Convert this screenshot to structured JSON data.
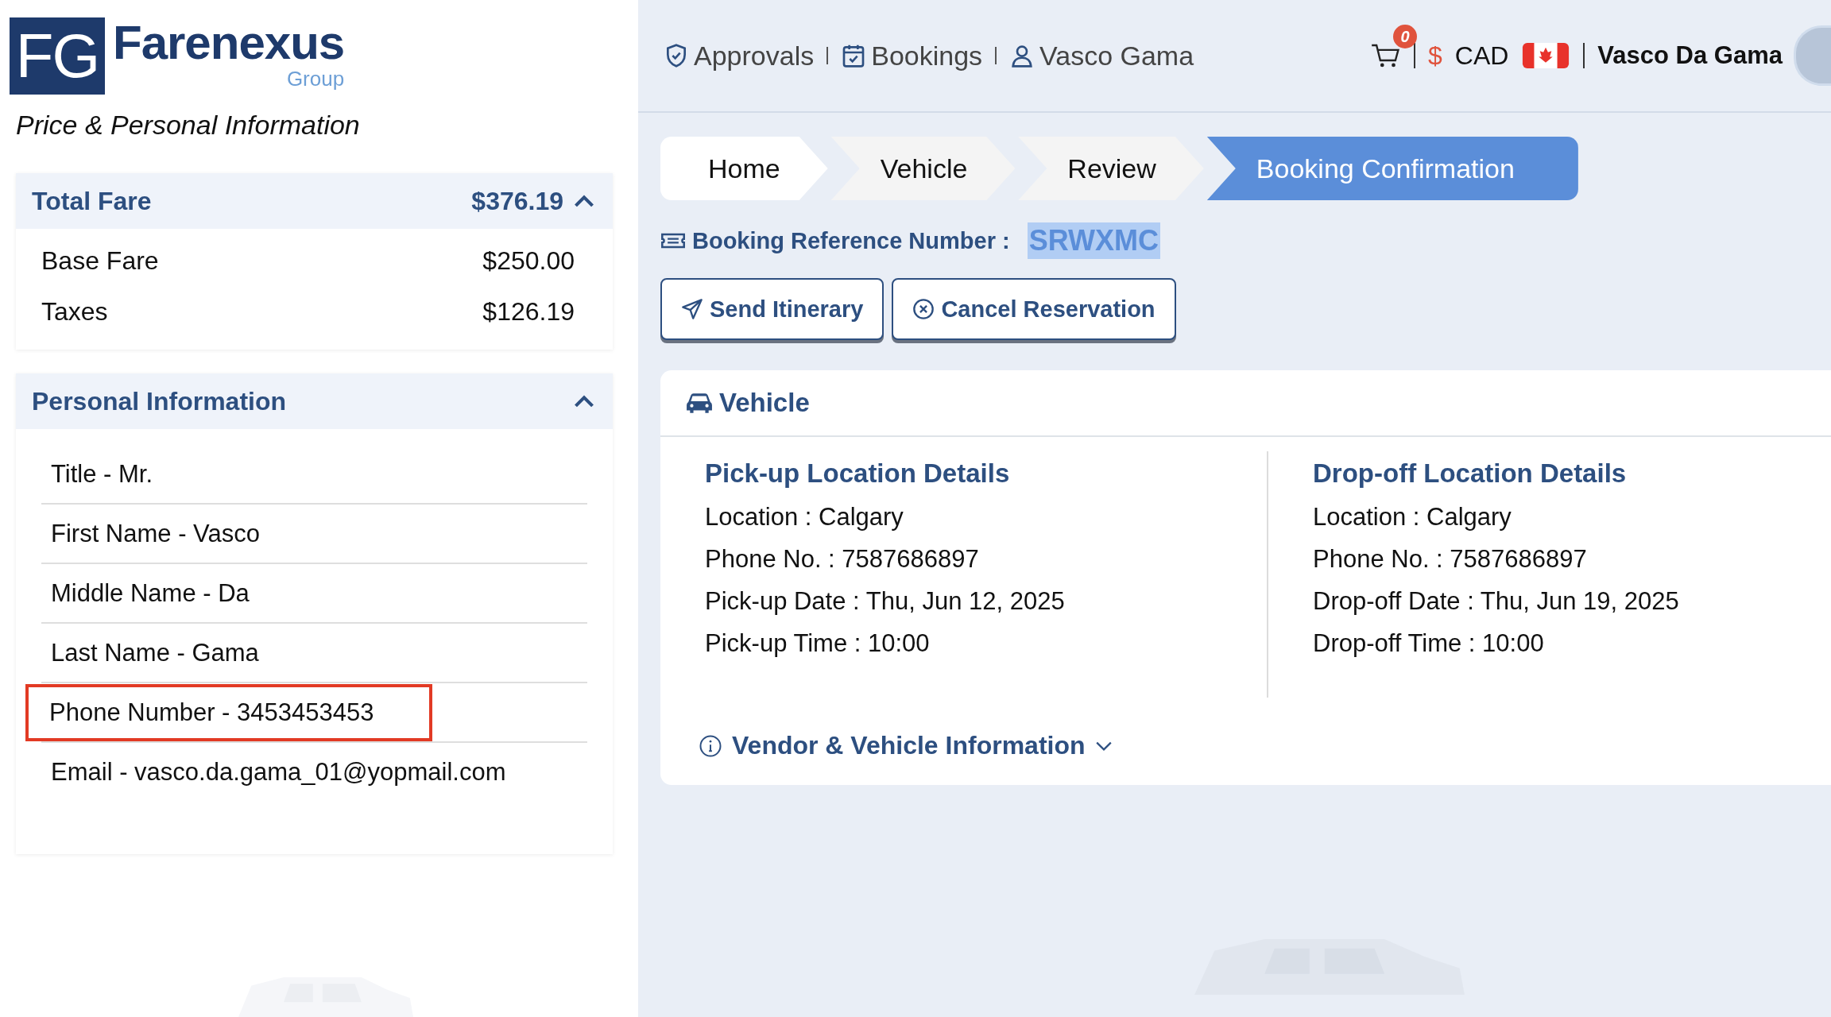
{
  "logo": {
    "mark": "FG",
    "name": "Farenexus",
    "sub": "Group"
  },
  "sidebar": {
    "title": "Price & Personal Information",
    "fare": {
      "title": "Total Fare",
      "total": "$376.19",
      "expanded": true,
      "rows": [
        {
          "label": "Base Fare",
          "value": "$250.00"
        },
        {
          "label": "Taxes",
          "value": "$126.19"
        }
      ]
    },
    "personal": {
      "title": "Personal Information",
      "expanded": true,
      "rows": [
        {
          "text": "Title - Mr.",
          "highlighted": false
        },
        {
          "text": "First Name - Vasco",
          "highlighted": false
        },
        {
          "text": "Middle Name - Da",
          "highlighted": false
        },
        {
          "text": "Last Name - Gama",
          "highlighted": false
        },
        {
          "text": "Phone Number - 3453453453",
          "highlighted": true
        },
        {
          "text": "Email - vasco.da.gama_01@yopmail.com",
          "highlighted": false
        }
      ]
    }
  },
  "nav": {
    "links": [
      {
        "kind": "shield",
        "label": "Approvals"
      },
      {
        "kind": "calendar",
        "label": "Bookings"
      },
      {
        "kind": "user",
        "label": "Vasco Gama"
      }
    ],
    "cart_count": "0",
    "currency_symbol": "$",
    "currency": "CAD",
    "user": "Vasco Da Gama"
  },
  "breadcrumb": [
    {
      "label": "Home",
      "selected": false
    },
    {
      "label": "Vehicle",
      "selected": false
    },
    {
      "label": "Review",
      "selected": false
    },
    {
      "label": "Booking Confirmation",
      "selected": true
    }
  ],
  "reference": {
    "label": "Booking Reference Number :",
    "value": "SRWXMC"
  },
  "buttons": [
    {
      "kind": "send",
      "label": "Send Itinerary"
    },
    {
      "kind": "cancel",
      "label": "Cancel Reservation"
    }
  ],
  "vehicle": {
    "title": "Vehicle",
    "columns": [
      {
        "title": "Pick-up Location Details",
        "lines": [
          "Location : Calgary",
          "Phone No. : 7587686897",
          "Pick-up Date : Thu, Jun 12, 2025",
          "Pick-up Time : 10:00"
        ]
      },
      {
        "title": "Drop-off Location Details",
        "lines": [
          "Location : Calgary",
          "Phone No. : 7587686897",
          "Drop-off Date : Thu, Jun 19, 2025",
          "Drop-off Time : 10:00"
        ]
      }
    ],
    "more": "Vendor & Vehicle Information"
  }
}
